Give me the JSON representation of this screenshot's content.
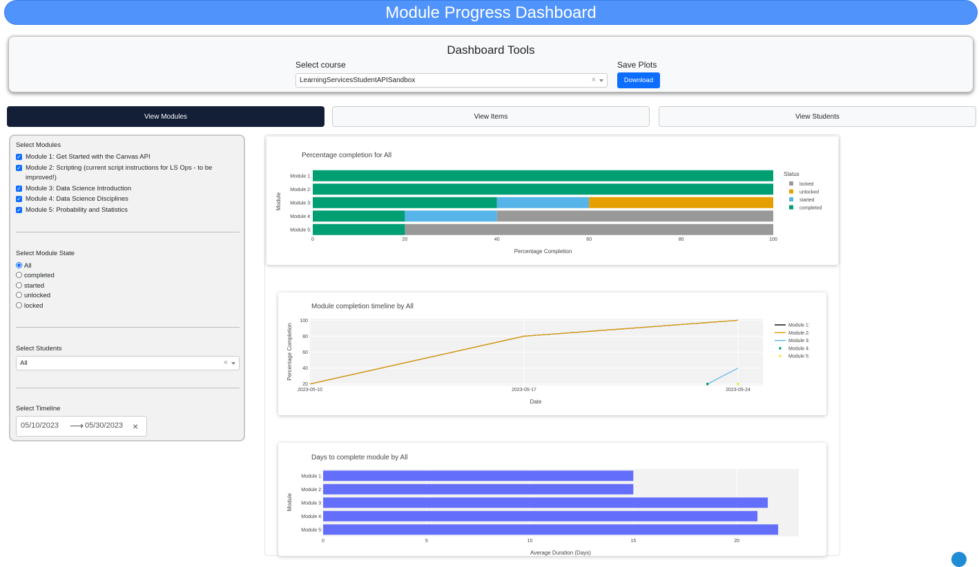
{
  "header": {
    "title": "Module Progress Dashboard"
  },
  "tools": {
    "title": "Dashboard Tools",
    "course_label": "Select course",
    "course_value": "LearningServicesStudentAPISandbox",
    "clear_symbol": "×",
    "save_label": "Save Plots",
    "download_label": "Download"
  },
  "tabs": [
    {
      "label": "View Modules",
      "active": true
    },
    {
      "label": "View Items",
      "active": false
    },
    {
      "label": "View Students",
      "active": false
    }
  ],
  "sidebar": {
    "modules_label": "Select Modules",
    "modules": [
      "Module 1: Get Started with the Canvas API",
      "Module 2: Scripting (current script instructions for LS Ops - to be improved!)",
      "Module 3: Data Science Introduction",
      "Module 4: Data Science Disciplines",
      "Module 5: Probability and Statistics"
    ],
    "state_label": "Select Module State",
    "states": [
      "All",
      "completed",
      "started",
      "unlocked",
      "locked"
    ],
    "selected_state": "All",
    "students_label": "Select Students",
    "students_value": "All",
    "timeline_label": "Select Timeline",
    "start_date": "05/10/2023",
    "end_date": "05/30/2023",
    "arrow": "⟶",
    "clear_symbol": "×"
  },
  "colors": {
    "completed": "#009e73",
    "started": "#56b4e9",
    "unlocked": "#e69f00",
    "locked": "#999999",
    "duration_bar": "#636efa",
    "accent": "#0d6efd",
    "header": "#4f93fb"
  },
  "chart_data": [
    {
      "type": "bar",
      "orientation": "horizontal-stacked",
      "title": "Percentage completion for All",
      "xlabel": "Percentage Completion",
      "ylabel": "Module",
      "categories": [
        "Module 1:",
        "Module 2:",
        "Module 3:",
        "Module 4:",
        "Module 5:"
      ],
      "xlim": [
        0,
        100
      ],
      "xticks": [
        0,
        20,
        40,
        60,
        80,
        100
      ],
      "legend_title": "Status",
      "legend_position": "right",
      "legend": [
        "locked",
        "unlocked",
        "started",
        "completed"
      ],
      "series": [
        {
          "name": "completed",
          "values": [
            100,
            100,
            40,
            20,
            20
          ]
        },
        {
          "name": "started",
          "values": [
            0,
            0,
            20,
            20,
            0
          ]
        },
        {
          "name": "unlocked",
          "values": [
            0,
            0,
            40,
            0,
            0
          ]
        },
        {
          "name": "locked",
          "values": [
            0,
            0,
            0,
            60,
            80
          ]
        }
      ]
    },
    {
      "type": "line",
      "title": "Module completion timeline by All",
      "xlabel": "Date",
      "ylabel": "Percentage Completion",
      "xticks": [
        "2023-05-10",
        "2023-05-17",
        "2023-05-24"
      ],
      "yticks": [
        20,
        40,
        60,
        80,
        100
      ],
      "ylim": [
        18,
        102
      ],
      "grid": true,
      "legend_position": "right",
      "series": [
        {
          "name": "Module 1:",
          "mode": "line",
          "color": "#000000",
          "x": [
            "2023-05-10",
            "2023-05-17",
            "2023-05-24"
          ],
          "y": [
            20,
            80,
            100
          ]
        },
        {
          "name": "Module 2:",
          "mode": "line",
          "color": "#e69f00",
          "x": [
            "2023-05-10",
            "2023-05-17",
            "2023-05-24"
          ],
          "y": [
            20,
            80,
            100
          ]
        },
        {
          "name": "Module 3:",
          "mode": "line",
          "color": "#56b4e9",
          "x": [
            "2023-05-23",
            "2023-05-24"
          ],
          "y": [
            20,
            40
          ]
        },
        {
          "name": "Module 4:",
          "mode": "markers",
          "color": "#009e73",
          "x": [
            "2023-05-23"
          ],
          "y": [
            20
          ]
        },
        {
          "name": "Module 5:",
          "mode": "markers",
          "color": "#f0e442",
          "x": [
            "2023-05-24"
          ],
          "y": [
            20
          ]
        }
      ]
    },
    {
      "type": "bar",
      "orientation": "horizontal",
      "title": "Days to complete module by All",
      "xlabel": "Average Duration (Days)",
      "ylabel": "Module",
      "categories": [
        "Module 1:",
        "Module 2:",
        "Module 3:",
        "Module 4:",
        "Module 5:"
      ],
      "values": [
        15,
        15,
        21.5,
        21,
        22
      ],
      "xticks": [
        0,
        5,
        10,
        15,
        20
      ],
      "xlim": [
        0,
        23
      ]
    }
  ]
}
